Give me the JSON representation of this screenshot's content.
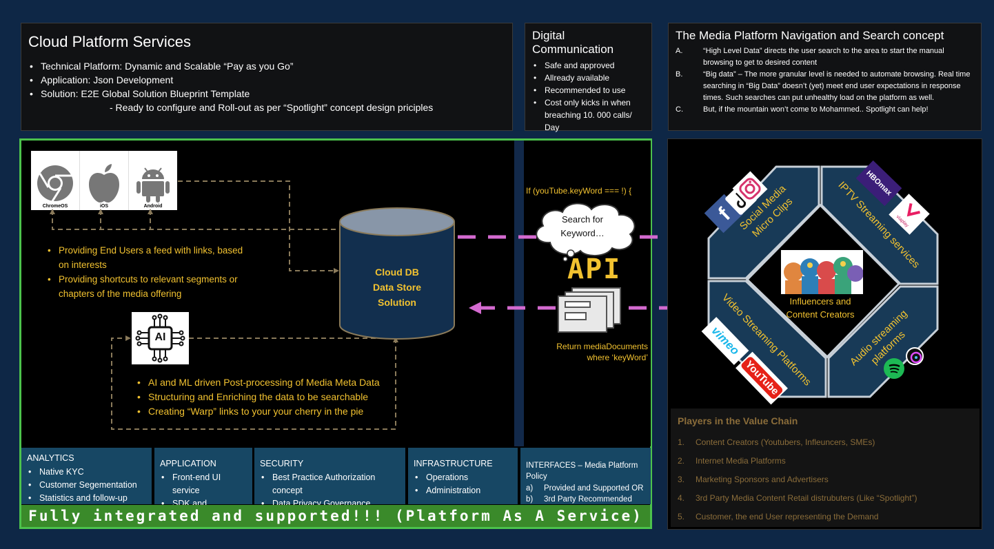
{
  "cloud_services": {
    "title": "Cloud Platform Services",
    "bullets": [
      "Technical Platform: Dynamic and Scalable “Pay as you Go”",
      "Application:  Json Development",
      "Solution: E2E Global Solution Blueprint Template"
    ],
    "sub": "- Ready to configure and Roll-out as per “Spotlight” concept design priciples"
  },
  "digital_communication": {
    "title": "Digital Communication",
    "bullets": [
      "Safe and approved",
      "Allready available",
      "Recommended to use",
      "Cost only kicks in when breaching 10. 000 calls/ Day"
    ]
  },
  "media_navigation": {
    "title": "The Media Platform Navigation and Search concept",
    "items": [
      {
        "num": "A.",
        "text": "“High Level Data” directs the user search to the area to start the manual browsing to get to desired content"
      },
      {
        "num": "B.",
        "text": "“Big data” – The more granular level is needed to automate browsing. Real time searching in “Big  Data” doesn’t (yet) meet end user expectations in response times. Such searches can put unhealthy load on the platform as well."
      },
      {
        "num": "C.",
        "text": "But, if the mountain won’t come to Mohammed.. Spotlight can help!"
      }
    ]
  },
  "platforms": {
    "labels": [
      "ChromeOS",
      "iOS",
      "Android"
    ]
  },
  "left_bullets": [
    "Providing End Users a feed with links, based on interests",
    "Providing shortcuts to relevant segments or chapters of the media offering"
  ],
  "database": {
    "lines": [
      "Cloud DB",
      "Data Store",
      "Solution"
    ]
  },
  "ai": {
    "label": "AI",
    "bullets": [
      "AI and ML driven Post-processing of Media Meta Data",
      "Structuring and Enriching the data to be searchable",
      "Creating “Warp” links to your your cherry in the pie"
    ]
  },
  "api": {
    "code": "If (youTube.keyWord === !) {",
    "cloud_text": "Search for Keyword…",
    "label": "API",
    "return_line1": "Return mediaDocuments",
    "return_line2": "where ‘keyWord’"
  },
  "services": {
    "analytics": {
      "title": "ANALYTICS",
      "items": [
        "Native KYC",
        "Customer Segementation",
        "Statistics and follow-up"
      ]
    },
    "application": {
      "title": "APPLICATION",
      "items": [
        "Front-end UI service",
        "SDK and"
      ]
    },
    "security": {
      "title": "SECURITY",
      "items": [
        "Best Practice Authorization concept",
        "Data Privacy Governance"
      ]
    },
    "infrastructure": {
      "title": "INFRASTRUCTURE",
      "items": [
        "Operations",
        "Administration"
      ]
    },
    "interfaces": {
      "title": "INTERFACES – Media Platform Policy",
      "items": [
        {
          "num": "a)",
          "text": "Provided and Supported OR"
        },
        {
          "num": "b)",
          "text": "3rd Party Recommended"
        }
      ]
    }
  },
  "footer": "Fully integrated and supported!!! (Platform As A Service)",
  "octagon": {
    "social": [
      "Social Media",
      "Micro Clips"
    ],
    "iptv": "IPTV Streaming services",
    "video": "Video Streaming Platforms",
    "audio": [
      "Audio streaming",
      "platforms"
    ],
    "center": [
      "Influencers and",
      "Content Creators"
    ],
    "logos": {
      "hbo": "HBOmax",
      "vimeo": "vimeo",
      "youtube": "YouTube",
      "viaplay": "viaplay",
      "chromeos_icon": "chrome-icon",
      "ios_icon": "apple-icon",
      "android_icon": "android-icon"
    }
  },
  "players": {
    "title": "Players in the Value Chain",
    "items": [
      {
        "num": "1.",
        "text": "Content Creators (Youtubers, Infleuncers, SMEs)"
      },
      {
        "num": "2.",
        "text": "Internet Media Platforms"
      },
      {
        "num": "3.",
        "text": "Marketing Sponsors and Advertisers"
      },
      {
        "num": "4.",
        "text": "3rd Party Media Content Retail distrubuters (Like “Spotlight”)"
      },
      {
        "num": "5.",
        "text": "Customer, the end User representing the Demand"
      }
    ]
  },
  "colors": {
    "background": "#0e2746",
    "green_frame": "#4cc24c",
    "yellow": "#f2c230",
    "service_panel": "#174764",
    "footer_bar": "#3a8a2a",
    "arrow_pink": "#d46ad0",
    "octagon_fill": "#183a57"
  }
}
